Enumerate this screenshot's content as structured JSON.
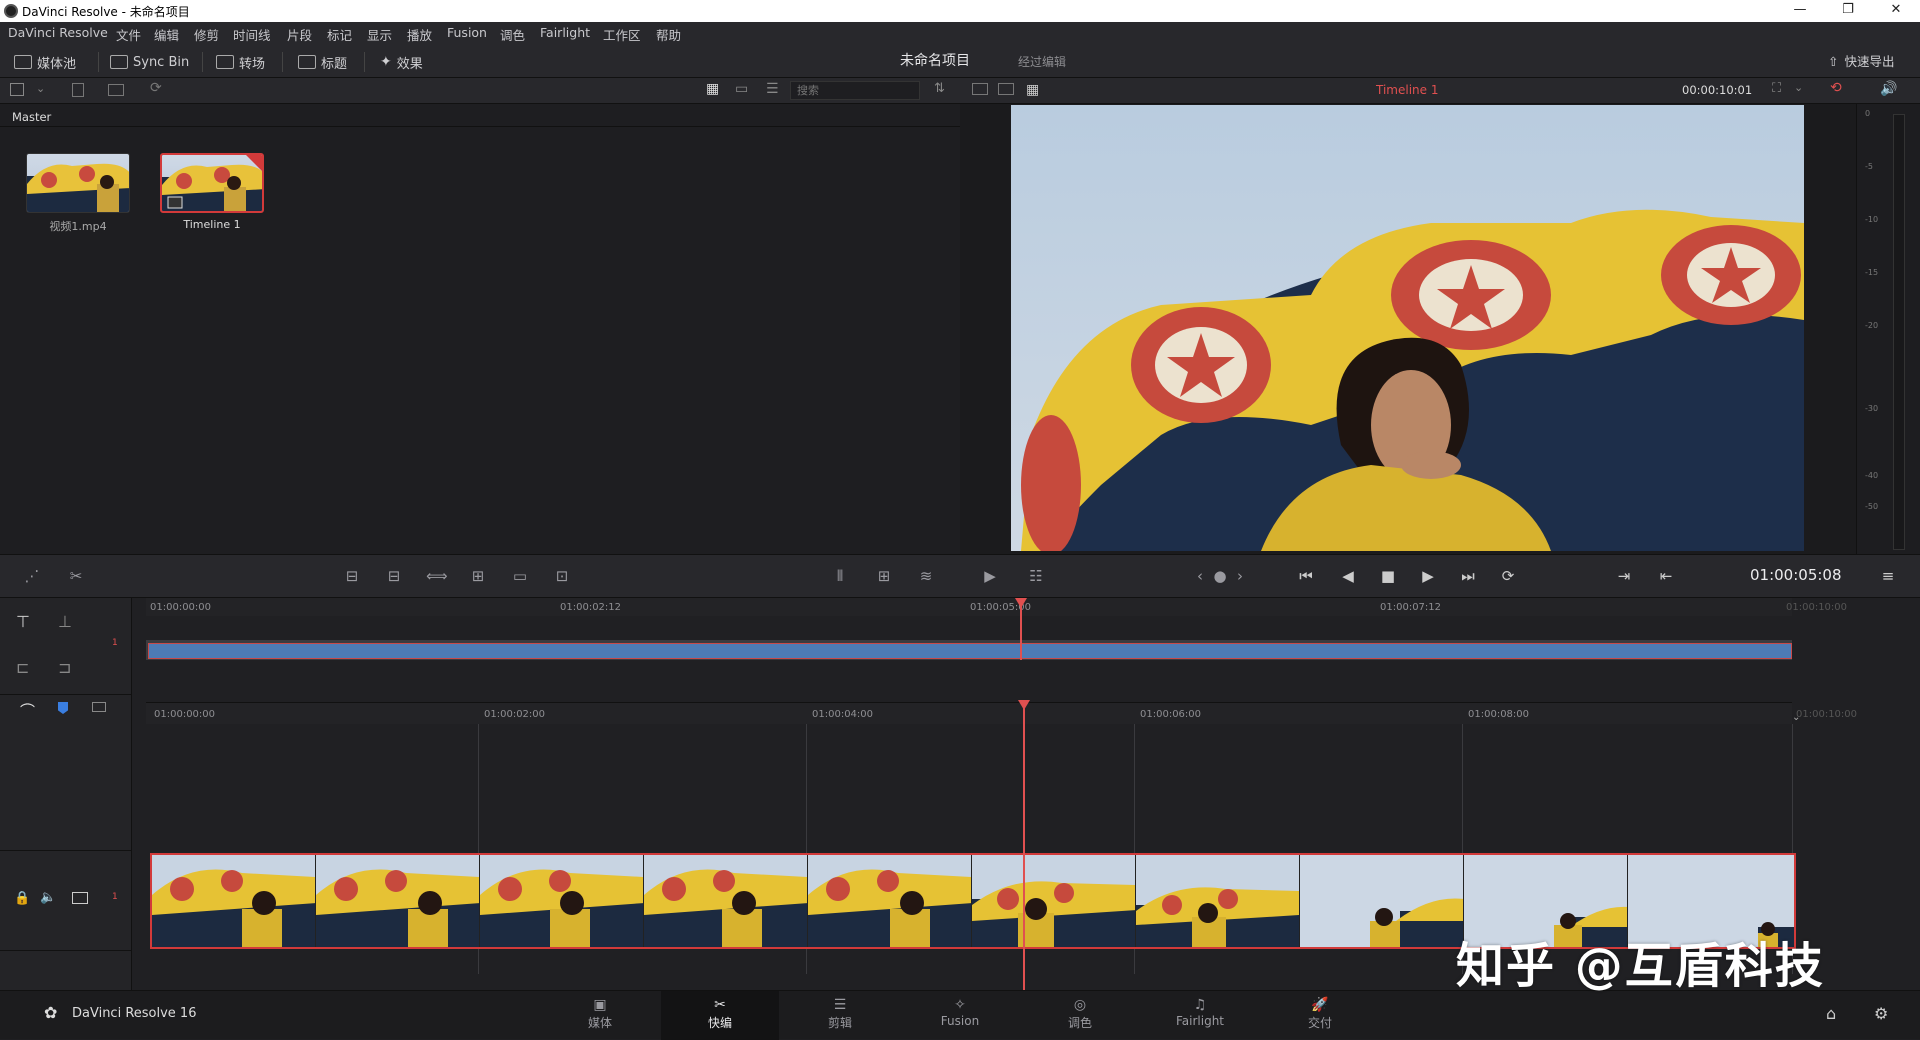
{
  "window": {
    "title": "DaVinci Resolve - 未命名项目",
    "minimize": "—",
    "maximize": "❐",
    "close": "✕"
  },
  "menu": [
    "DaVinci Resolve",
    "文件",
    "编辑",
    "修剪",
    "时间线",
    "片段",
    "标记",
    "显示",
    "播放",
    "Fusion",
    "调色",
    "Fairlight",
    "工作区",
    "帮助"
  ],
  "toolbar": {
    "media_pool": "媒体池",
    "sync_bin": "Sync Bin",
    "transitions": "转场",
    "titles": "标题",
    "effects": "效果",
    "project_name": "未命名项目",
    "project_status": "经过编辑",
    "quick_export": "快速导出"
  },
  "media": {
    "search_placeholder": "搜索",
    "bin": "Master",
    "clips": [
      {
        "name": "视频1.mp4"
      },
      {
        "name": "Timeline 1"
      }
    ]
  },
  "viewer": {
    "timeline_name": "Timeline 1",
    "duration": "00:00:10:01",
    "timecode": "01:00:05:08"
  },
  "meter": {
    "ticks": [
      "0",
      "-5",
      "-10",
      "-15",
      "-20",
      "-30",
      "-40",
      "-50"
    ]
  },
  "upper_ruler": [
    "01:00:00:00",
    "01:00:02:12",
    "01:00:05:00",
    "01:00:07:12",
    "01:00:10:00"
  ],
  "lower_ruler": [
    "01:00:00:00",
    "01:00:02:00",
    "01:00:04:00",
    "01:00:06:00",
    "01:00:08:00",
    "01:00:10:00"
  ],
  "tracks": {
    "upper_index": "1",
    "lower_index": "1"
  },
  "footer": {
    "app": "DaVinci Resolve 16",
    "pages": [
      {
        "label": "媒体",
        "icon": "▣"
      },
      {
        "label": "快编",
        "icon": "✂"
      },
      {
        "label": "剪辑",
        "icon": "☰"
      },
      {
        "label": "Fusion",
        "icon": "✧"
      },
      {
        "label": "调色",
        "icon": "◎"
      },
      {
        "label": "Fairlight",
        "icon": "♫"
      },
      {
        "label": "交付",
        "icon": "🚀"
      }
    ]
  },
  "watermark": "知乎 @互盾科技",
  "colors": {
    "accent_red": "#e05050",
    "clip_blue": "#4d7bb5"
  }
}
